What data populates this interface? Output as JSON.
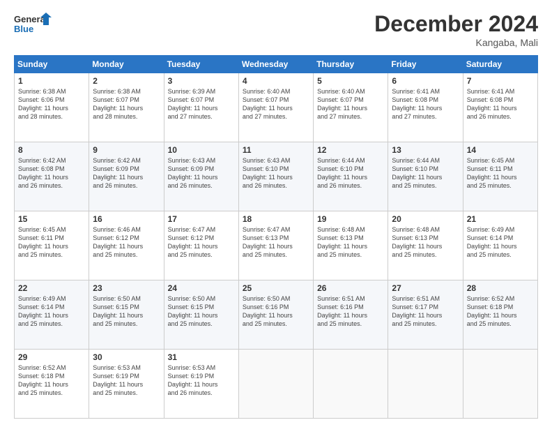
{
  "logo": {
    "line1": "General",
    "line2": "Blue"
  },
  "title": "December 2024",
  "location": "Kangaba, Mali",
  "days_of_week": [
    "Sunday",
    "Monday",
    "Tuesday",
    "Wednesday",
    "Thursday",
    "Friday",
    "Saturday"
  ],
  "weeks": [
    [
      {
        "day": "1",
        "info": "Sunrise: 6:38 AM\nSunset: 6:06 PM\nDaylight: 11 hours\nand 28 minutes."
      },
      {
        "day": "2",
        "info": "Sunrise: 6:38 AM\nSunset: 6:07 PM\nDaylight: 11 hours\nand 28 minutes."
      },
      {
        "day": "3",
        "info": "Sunrise: 6:39 AM\nSunset: 6:07 PM\nDaylight: 11 hours\nand 27 minutes."
      },
      {
        "day": "4",
        "info": "Sunrise: 6:40 AM\nSunset: 6:07 PM\nDaylight: 11 hours\nand 27 minutes."
      },
      {
        "day": "5",
        "info": "Sunrise: 6:40 AM\nSunset: 6:07 PM\nDaylight: 11 hours\nand 27 minutes."
      },
      {
        "day": "6",
        "info": "Sunrise: 6:41 AM\nSunset: 6:08 PM\nDaylight: 11 hours\nand 27 minutes."
      },
      {
        "day": "7",
        "info": "Sunrise: 6:41 AM\nSunset: 6:08 PM\nDaylight: 11 hours\nand 26 minutes."
      }
    ],
    [
      {
        "day": "8",
        "info": "Sunrise: 6:42 AM\nSunset: 6:08 PM\nDaylight: 11 hours\nand 26 minutes."
      },
      {
        "day": "9",
        "info": "Sunrise: 6:42 AM\nSunset: 6:09 PM\nDaylight: 11 hours\nand 26 minutes."
      },
      {
        "day": "10",
        "info": "Sunrise: 6:43 AM\nSunset: 6:09 PM\nDaylight: 11 hours\nand 26 minutes."
      },
      {
        "day": "11",
        "info": "Sunrise: 6:43 AM\nSunset: 6:10 PM\nDaylight: 11 hours\nand 26 minutes."
      },
      {
        "day": "12",
        "info": "Sunrise: 6:44 AM\nSunset: 6:10 PM\nDaylight: 11 hours\nand 26 minutes."
      },
      {
        "day": "13",
        "info": "Sunrise: 6:44 AM\nSunset: 6:10 PM\nDaylight: 11 hours\nand 25 minutes."
      },
      {
        "day": "14",
        "info": "Sunrise: 6:45 AM\nSunset: 6:11 PM\nDaylight: 11 hours\nand 25 minutes."
      }
    ],
    [
      {
        "day": "15",
        "info": "Sunrise: 6:45 AM\nSunset: 6:11 PM\nDaylight: 11 hours\nand 25 minutes."
      },
      {
        "day": "16",
        "info": "Sunrise: 6:46 AM\nSunset: 6:12 PM\nDaylight: 11 hours\nand 25 minutes."
      },
      {
        "day": "17",
        "info": "Sunrise: 6:47 AM\nSunset: 6:12 PM\nDaylight: 11 hours\nand 25 minutes."
      },
      {
        "day": "18",
        "info": "Sunrise: 6:47 AM\nSunset: 6:13 PM\nDaylight: 11 hours\nand 25 minutes."
      },
      {
        "day": "19",
        "info": "Sunrise: 6:48 AM\nSunset: 6:13 PM\nDaylight: 11 hours\nand 25 minutes."
      },
      {
        "day": "20",
        "info": "Sunrise: 6:48 AM\nSunset: 6:13 PM\nDaylight: 11 hours\nand 25 minutes."
      },
      {
        "day": "21",
        "info": "Sunrise: 6:49 AM\nSunset: 6:14 PM\nDaylight: 11 hours\nand 25 minutes."
      }
    ],
    [
      {
        "day": "22",
        "info": "Sunrise: 6:49 AM\nSunset: 6:14 PM\nDaylight: 11 hours\nand 25 minutes."
      },
      {
        "day": "23",
        "info": "Sunrise: 6:50 AM\nSunset: 6:15 PM\nDaylight: 11 hours\nand 25 minutes."
      },
      {
        "day": "24",
        "info": "Sunrise: 6:50 AM\nSunset: 6:15 PM\nDaylight: 11 hours\nand 25 minutes."
      },
      {
        "day": "25",
        "info": "Sunrise: 6:50 AM\nSunset: 6:16 PM\nDaylight: 11 hours\nand 25 minutes."
      },
      {
        "day": "26",
        "info": "Sunrise: 6:51 AM\nSunset: 6:16 PM\nDaylight: 11 hours\nand 25 minutes."
      },
      {
        "day": "27",
        "info": "Sunrise: 6:51 AM\nSunset: 6:17 PM\nDaylight: 11 hours\nand 25 minutes."
      },
      {
        "day": "28",
        "info": "Sunrise: 6:52 AM\nSunset: 6:18 PM\nDaylight: 11 hours\nand 25 minutes."
      }
    ],
    [
      {
        "day": "29",
        "info": "Sunrise: 6:52 AM\nSunset: 6:18 PM\nDaylight: 11 hours\nand 25 minutes."
      },
      {
        "day": "30",
        "info": "Sunrise: 6:53 AM\nSunset: 6:19 PM\nDaylight: 11 hours\nand 25 minutes."
      },
      {
        "day": "31",
        "info": "Sunrise: 6:53 AM\nSunset: 6:19 PM\nDaylight: 11 hours\nand 26 minutes."
      },
      null,
      null,
      null,
      null
    ]
  ]
}
